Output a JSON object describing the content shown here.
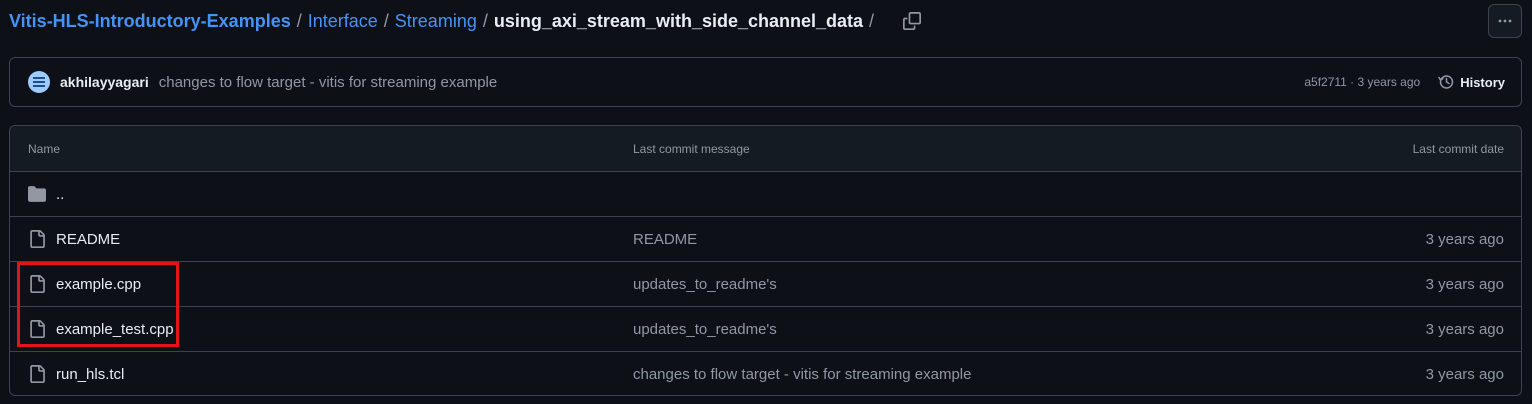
{
  "breadcrumb": {
    "repo": "Vitis-HLS-Introductory-Examples",
    "path1": "Interface",
    "path2": "Streaming",
    "current": "using_axi_stream_with_side_channel_data",
    "separator": "/"
  },
  "commit": {
    "author": "akhilayyagari",
    "message": "changes to flow target - vitis for streaming example",
    "meta": "a5f2711 · 3 years ago",
    "history_label": "History"
  },
  "table": {
    "headers": {
      "name": "Name",
      "message": "Last commit message",
      "date": "Last commit date"
    },
    "parent": "..",
    "rows": [
      {
        "name": "README",
        "message": "README",
        "date": "3 years ago",
        "icon": "file-icon"
      },
      {
        "name": "example.cpp",
        "message": "updates_to_readme's",
        "date": "3 years ago",
        "icon": "file-icon"
      },
      {
        "name": "example_test.cpp",
        "message": "updates_to_readme's",
        "date": "3 years ago",
        "icon": "file-icon"
      },
      {
        "name": "run_hls.tcl",
        "message": "changes to flow target - vitis for streaming example",
        "date": "3 years ago",
        "icon": "file-icon"
      }
    ]
  },
  "colors": {
    "background": "#0d1117",
    "link": "#4493f8",
    "muted": "#9198a1",
    "border": "#3d444d",
    "highlight": "#e0151b"
  }
}
